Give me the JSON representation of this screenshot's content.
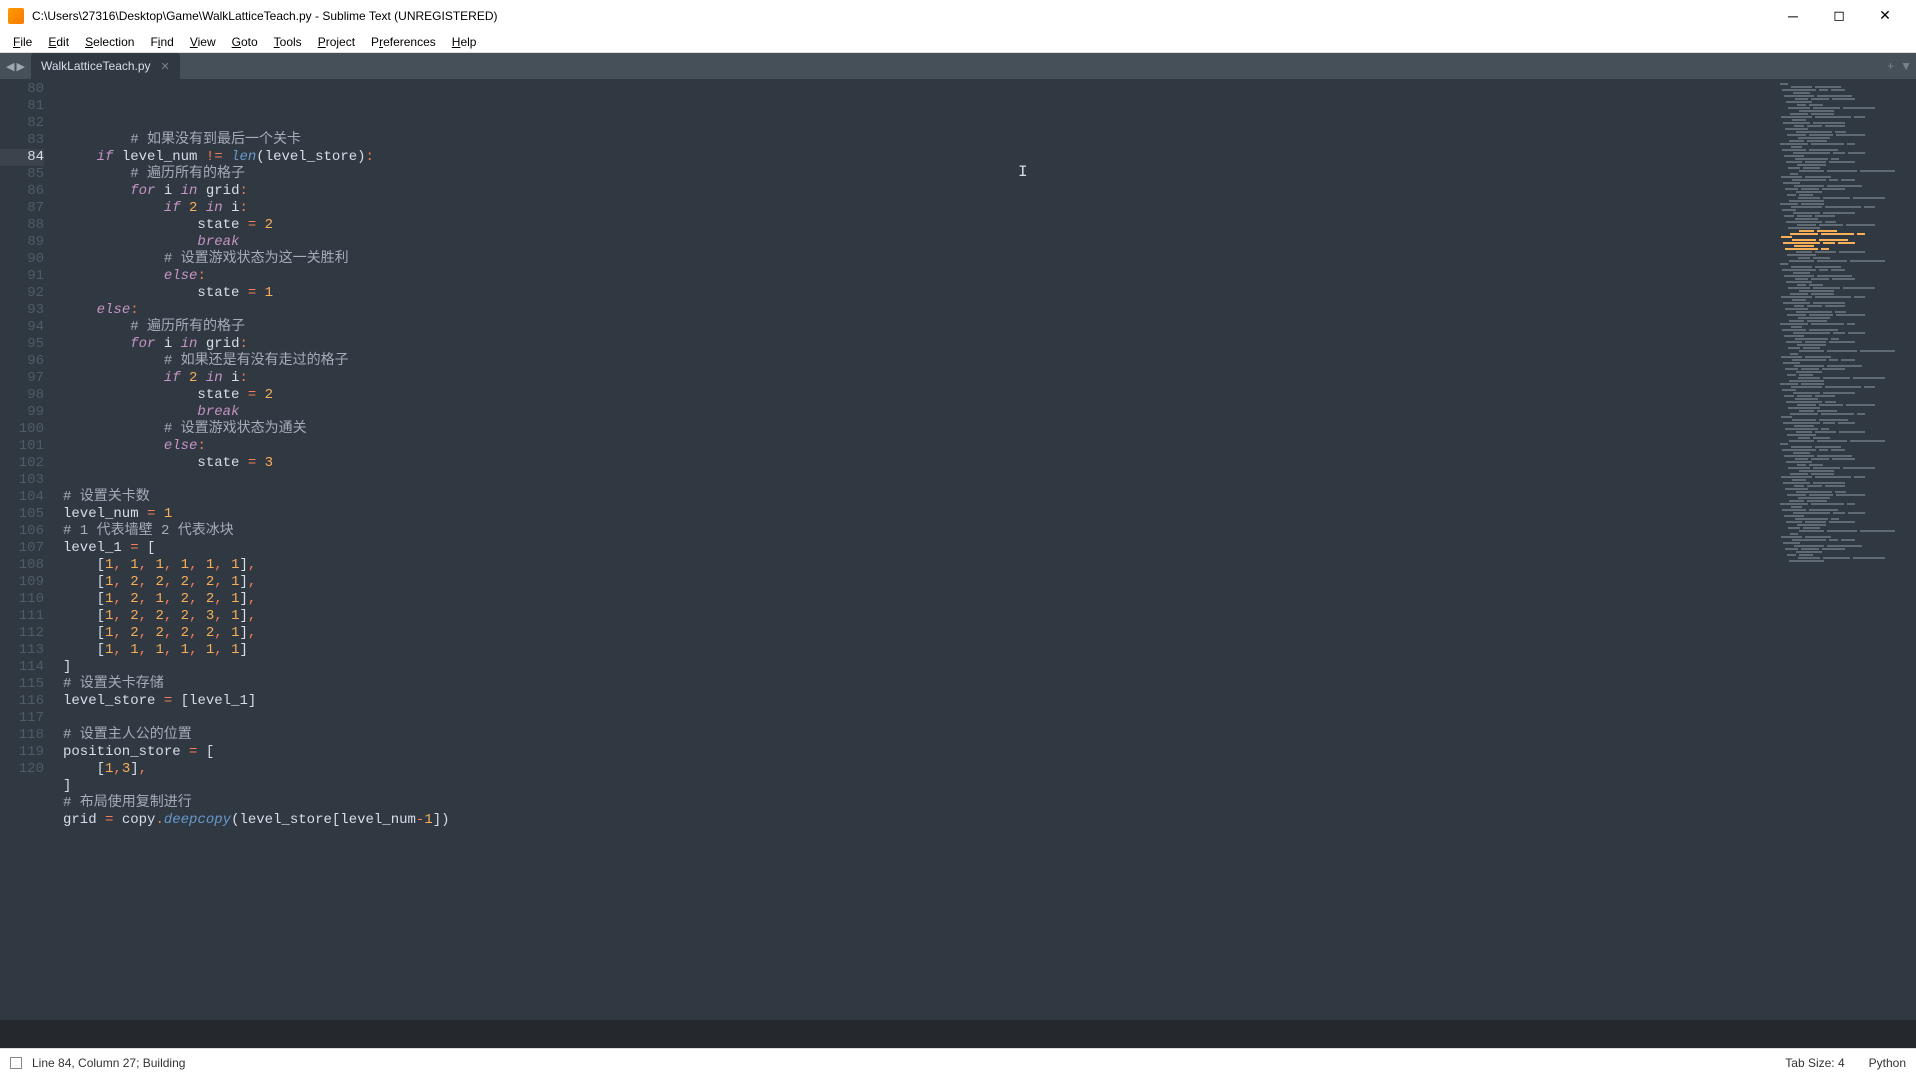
{
  "window": {
    "title": "C:\\Users\\27316\\Desktop\\Game\\WalkLatticeTeach.py - Sublime Text (UNREGISTERED)"
  },
  "menu": {
    "file": "File",
    "edit": "Edit",
    "selection": "Selection",
    "find": "Find",
    "view": "View",
    "goto": "Goto",
    "tools": "Tools",
    "project": "Project",
    "preferences": "Preferences",
    "help": "Help"
  },
  "tab": {
    "name": "WalkLatticeTeach.py"
  },
  "gutter": {
    "start": 80,
    "end": 120,
    "active": 84
  },
  "code_lines": [
    {
      "n": 80,
      "i": 8,
      "t": "comment",
      "text": "# 如果没有到最后一个关卡"
    },
    {
      "n": 81,
      "i": 4,
      "raw": [
        [
          "kw",
          "if"
        ],
        [
          "sp",
          " "
        ],
        [
          "id",
          "level_num"
        ],
        [
          "sp",
          " "
        ],
        [
          "op",
          "!="
        ],
        [
          "sp",
          " "
        ],
        [
          "fn",
          "len"
        ],
        [
          "br",
          "("
        ],
        [
          "id",
          "level_store"
        ],
        [
          "br",
          ")"
        ],
        [
          "op",
          ":"
        ]
      ]
    },
    {
      "n": 82,
      "i": 8,
      "t": "comment",
      "text": "# 遍历所有的格子"
    },
    {
      "n": 83,
      "i": 8,
      "raw": [
        [
          "kw",
          "for"
        ],
        [
          "sp",
          " "
        ],
        [
          "id",
          "i"
        ],
        [
          "sp",
          " "
        ],
        [
          "kw",
          "in"
        ],
        [
          "sp",
          " "
        ],
        [
          "id",
          "grid"
        ],
        [
          "op",
          ":"
        ]
      ]
    },
    {
      "n": 84,
      "i": 12,
      "raw": [
        [
          "kw",
          "if"
        ],
        [
          "sp",
          " "
        ],
        [
          "num",
          "2"
        ],
        [
          "sp",
          " "
        ],
        [
          "kw",
          "in"
        ],
        [
          "sp",
          " "
        ],
        [
          "id",
          "i"
        ],
        [
          "op",
          ":"
        ]
      ]
    },
    {
      "n": 85,
      "i": 16,
      "raw": [
        [
          "id",
          "state"
        ],
        [
          "sp",
          " "
        ],
        [
          "op",
          "="
        ],
        [
          "sp",
          " "
        ],
        [
          "num",
          "2"
        ]
      ]
    },
    {
      "n": 86,
      "i": 16,
      "raw": [
        [
          "kw",
          "break"
        ]
      ]
    },
    {
      "n": 87,
      "i": 12,
      "t": "comment",
      "text": "# 设置游戏状态为这一关胜利"
    },
    {
      "n": 88,
      "i": 12,
      "raw": [
        [
          "kw",
          "else"
        ],
        [
          "op",
          ":"
        ]
      ]
    },
    {
      "n": 89,
      "i": 16,
      "raw": [
        [
          "id",
          "state"
        ],
        [
          "sp",
          " "
        ],
        [
          "op",
          "="
        ],
        [
          "sp",
          " "
        ],
        [
          "num",
          "1"
        ]
      ]
    },
    {
      "n": 90,
      "i": 4,
      "raw": [
        [
          "kw",
          "else"
        ],
        [
          "op",
          ":"
        ]
      ]
    },
    {
      "n": 91,
      "i": 8,
      "t": "comment",
      "text": "# 遍历所有的格子"
    },
    {
      "n": 92,
      "i": 8,
      "raw": [
        [
          "kw",
          "for"
        ],
        [
          "sp",
          " "
        ],
        [
          "id",
          "i"
        ],
        [
          "sp",
          " "
        ],
        [
          "kw",
          "in"
        ],
        [
          "sp",
          " "
        ],
        [
          "id",
          "grid"
        ],
        [
          "op",
          ":"
        ]
      ]
    },
    {
      "n": 93,
      "i": 12,
      "t": "comment",
      "text": "# 如果还是有没有走过的格子"
    },
    {
      "n": 94,
      "i": 12,
      "raw": [
        [
          "kw",
          "if"
        ],
        [
          "sp",
          " "
        ],
        [
          "num",
          "2"
        ],
        [
          "sp",
          " "
        ],
        [
          "kw",
          "in"
        ],
        [
          "sp",
          " "
        ],
        [
          "id",
          "i"
        ],
        [
          "op",
          ":"
        ]
      ]
    },
    {
      "n": 95,
      "i": 16,
      "raw": [
        [
          "id",
          "state"
        ],
        [
          "sp",
          " "
        ],
        [
          "op",
          "="
        ],
        [
          "sp",
          " "
        ],
        [
          "num",
          "2"
        ]
      ]
    },
    {
      "n": 96,
      "i": 16,
      "raw": [
        [
          "kw",
          "break"
        ]
      ]
    },
    {
      "n": 97,
      "i": 12,
      "t": "comment",
      "text": "# 设置游戏状态为通关"
    },
    {
      "n": 98,
      "i": 12,
      "raw": [
        [
          "kw",
          "else"
        ],
        [
          "op",
          ":"
        ]
      ]
    },
    {
      "n": 99,
      "i": 16,
      "raw": [
        [
          "id",
          "state"
        ],
        [
          "sp",
          " "
        ],
        [
          "op",
          "="
        ],
        [
          "sp",
          " "
        ],
        [
          "num",
          "3"
        ]
      ]
    },
    {
      "n": 100,
      "i": 0,
      "raw": []
    },
    {
      "n": 101,
      "i": 0,
      "t": "comment",
      "text": "# 设置关卡数"
    },
    {
      "n": 102,
      "i": 0,
      "raw": [
        [
          "id",
          "level_num"
        ],
        [
          "sp",
          " "
        ],
        [
          "op",
          "="
        ],
        [
          "sp",
          " "
        ],
        [
          "num",
          "1"
        ]
      ]
    },
    {
      "n": 103,
      "i": 0,
      "t": "comment",
      "text": "# 1 代表墙壁 2 代表冰块"
    },
    {
      "n": 104,
      "i": 0,
      "raw": [
        [
          "id",
          "level_1"
        ],
        [
          "sp",
          " "
        ],
        [
          "op",
          "="
        ],
        [
          "sp",
          " "
        ],
        [
          "br",
          "["
        ]
      ]
    },
    {
      "n": 105,
      "i": 4,
      "raw": [
        [
          "br",
          "["
        ],
        [
          "num",
          "1"
        ],
        [
          "op",
          ","
        ],
        [
          "sp",
          " "
        ],
        [
          "num",
          "1"
        ],
        [
          "op",
          ","
        ],
        [
          "sp",
          " "
        ],
        [
          "num",
          "1"
        ],
        [
          "op",
          ","
        ],
        [
          "sp",
          " "
        ],
        [
          "num",
          "1"
        ],
        [
          "op",
          ","
        ],
        [
          "sp",
          " "
        ],
        [
          "num",
          "1"
        ],
        [
          "op",
          ","
        ],
        [
          "sp",
          " "
        ],
        [
          "num",
          "1"
        ],
        [
          "br",
          "]"
        ],
        [
          "op",
          ","
        ]
      ]
    },
    {
      "n": 106,
      "i": 4,
      "raw": [
        [
          "br",
          "["
        ],
        [
          "num",
          "1"
        ],
        [
          "op",
          ","
        ],
        [
          "sp",
          " "
        ],
        [
          "num",
          "2"
        ],
        [
          "op",
          ","
        ],
        [
          "sp",
          " "
        ],
        [
          "num",
          "2"
        ],
        [
          "op",
          ","
        ],
        [
          "sp",
          " "
        ],
        [
          "num",
          "2"
        ],
        [
          "op",
          ","
        ],
        [
          "sp",
          " "
        ],
        [
          "num",
          "2"
        ],
        [
          "op",
          ","
        ],
        [
          "sp",
          " "
        ],
        [
          "num",
          "1"
        ],
        [
          "br",
          "]"
        ],
        [
          "op",
          ","
        ]
      ]
    },
    {
      "n": 107,
      "i": 4,
      "raw": [
        [
          "br",
          "["
        ],
        [
          "num",
          "1"
        ],
        [
          "op",
          ","
        ],
        [
          "sp",
          " "
        ],
        [
          "num",
          "2"
        ],
        [
          "op",
          ","
        ],
        [
          "sp",
          " "
        ],
        [
          "num",
          "1"
        ],
        [
          "op",
          ","
        ],
        [
          "sp",
          " "
        ],
        [
          "num",
          "2"
        ],
        [
          "op",
          ","
        ],
        [
          "sp",
          " "
        ],
        [
          "num",
          "2"
        ],
        [
          "op",
          ","
        ],
        [
          "sp",
          " "
        ],
        [
          "num",
          "1"
        ],
        [
          "br",
          "]"
        ],
        [
          "op",
          ","
        ]
      ]
    },
    {
      "n": 108,
      "i": 4,
      "raw": [
        [
          "br",
          "["
        ],
        [
          "num",
          "1"
        ],
        [
          "op",
          ","
        ],
        [
          "sp",
          " "
        ],
        [
          "num",
          "2"
        ],
        [
          "op",
          ","
        ],
        [
          "sp",
          " "
        ],
        [
          "num",
          "2"
        ],
        [
          "op",
          ","
        ],
        [
          "sp",
          " "
        ],
        [
          "num",
          "2"
        ],
        [
          "op",
          ","
        ],
        [
          "sp",
          " "
        ],
        [
          "num",
          "3"
        ],
        [
          "op",
          ","
        ],
        [
          "sp",
          " "
        ],
        [
          "num",
          "1"
        ],
        [
          "br",
          "]"
        ],
        [
          "op",
          ","
        ]
      ]
    },
    {
      "n": 109,
      "i": 4,
      "raw": [
        [
          "br",
          "["
        ],
        [
          "num",
          "1"
        ],
        [
          "op",
          ","
        ],
        [
          "sp",
          " "
        ],
        [
          "num",
          "2"
        ],
        [
          "op",
          ","
        ],
        [
          "sp",
          " "
        ],
        [
          "num",
          "2"
        ],
        [
          "op",
          ","
        ],
        [
          "sp",
          " "
        ],
        [
          "num",
          "2"
        ],
        [
          "op",
          ","
        ],
        [
          "sp",
          " "
        ],
        [
          "num",
          "2"
        ],
        [
          "op",
          ","
        ],
        [
          "sp",
          " "
        ],
        [
          "num",
          "1"
        ],
        [
          "br",
          "]"
        ],
        [
          "op",
          ","
        ]
      ]
    },
    {
      "n": 110,
      "i": 4,
      "raw": [
        [
          "br",
          "["
        ],
        [
          "num",
          "1"
        ],
        [
          "op",
          ","
        ],
        [
          "sp",
          " "
        ],
        [
          "num",
          "1"
        ],
        [
          "op",
          ","
        ],
        [
          "sp",
          " "
        ],
        [
          "num",
          "1"
        ],
        [
          "op",
          ","
        ],
        [
          "sp",
          " "
        ],
        [
          "num",
          "1"
        ],
        [
          "op",
          ","
        ],
        [
          "sp",
          " "
        ],
        [
          "num",
          "1"
        ],
        [
          "op",
          ","
        ],
        [
          "sp",
          " "
        ],
        [
          "num",
          "1"
        ],
        [
          "br",
          "]"
        ]
      ]
    },
    {
      "n": 111,
      "i": 0,
      "raw": [
        [
          "br",
          "]"
        ]
      ]
    },
    {
      "n": 112,
      "i": 0,
      "t": "comment",
      "text": "# 设置关卡存储"
    },
    {
      "n": 113,
      "i": 0,
      "raw": [
        [
          "id",
          "level_store"
        ],
        [
          "sp",
          " "
        ],
        [
          "op",
          "="
        ],
        [
          "sp",
          " "
        ],
        [
          "br",
          "["
        ],
        [
          "id",
          "level_1"
        ],
        [
          "br",
          "]"
        ]
      ]
    },
    {
      "n": 114,
      "i": 0,
      "raw": []
    },
    {
      "n": 115,
      "i": 0,
      "t": "comment",
      "text": "# 设置主人公的位置"
    },
    {
      "n": 116,
      "i": 0,
      "raw": [
        [
          "id",
          "position_store"
        ],
        [
          "sp",
          " "
        ],
        [
          "op",
          "="
        ],
        [
          "sp",
          " "
        ],
        [
          "br",
          "["
        ]
      ]
    },
    {
      "n": 117,
      "i": 4,
      "raw": [
        [
          "br",
          "["
        ],
        [
          "num",
          "1"
        ],
        [
          "op",
          ","
        ],
        [
          "num",
          "3"
        ],
        [
          "br",
          "]"
        ],
        [
          "op",
          ","
        ]
      ]
    },
    {
      "n": 118,
      "i": 0,
      "raw": [
        [
          "br",
          "]"
        ]
      ]
    },
    {
      "n": 119,
      "i": 0,
      "t": "comment",
      "text": "# 布局使用复制进行"
    },
    {
      "n": 120,
      "i": 0,
      "raw": [
        [
          "id",
          "grid"
        ],
        [
          "sp",
          " "
        ],
        [
          "op",
          "="
        ],
        [
          "sp",
          " "
        ],
        [
          "id",
          "copy"
        ],
        [
          "op",
          "."
        ],
        [
          "fn",
          "deepcopy"
        ],
        [
          "br",
          "("
        ],
        [
          "id",
          "level_store"
        ],
        [
          "br",
          "["
        ],
        [
          "id",
          "level_num"
        ],
        [
          "op",
          "-"
        ],
        [
          "num",
          "1"
        ],
        [
          "br",
          "]"
        ],
        [
          "br",
          ")"
        ]
      ]
    }
  ],
  "status": {
    "left": "Line 84, Column 27; Building",
    "tabsize": "Tab Size: 4",
    "syntax": "Python"
  }
}
